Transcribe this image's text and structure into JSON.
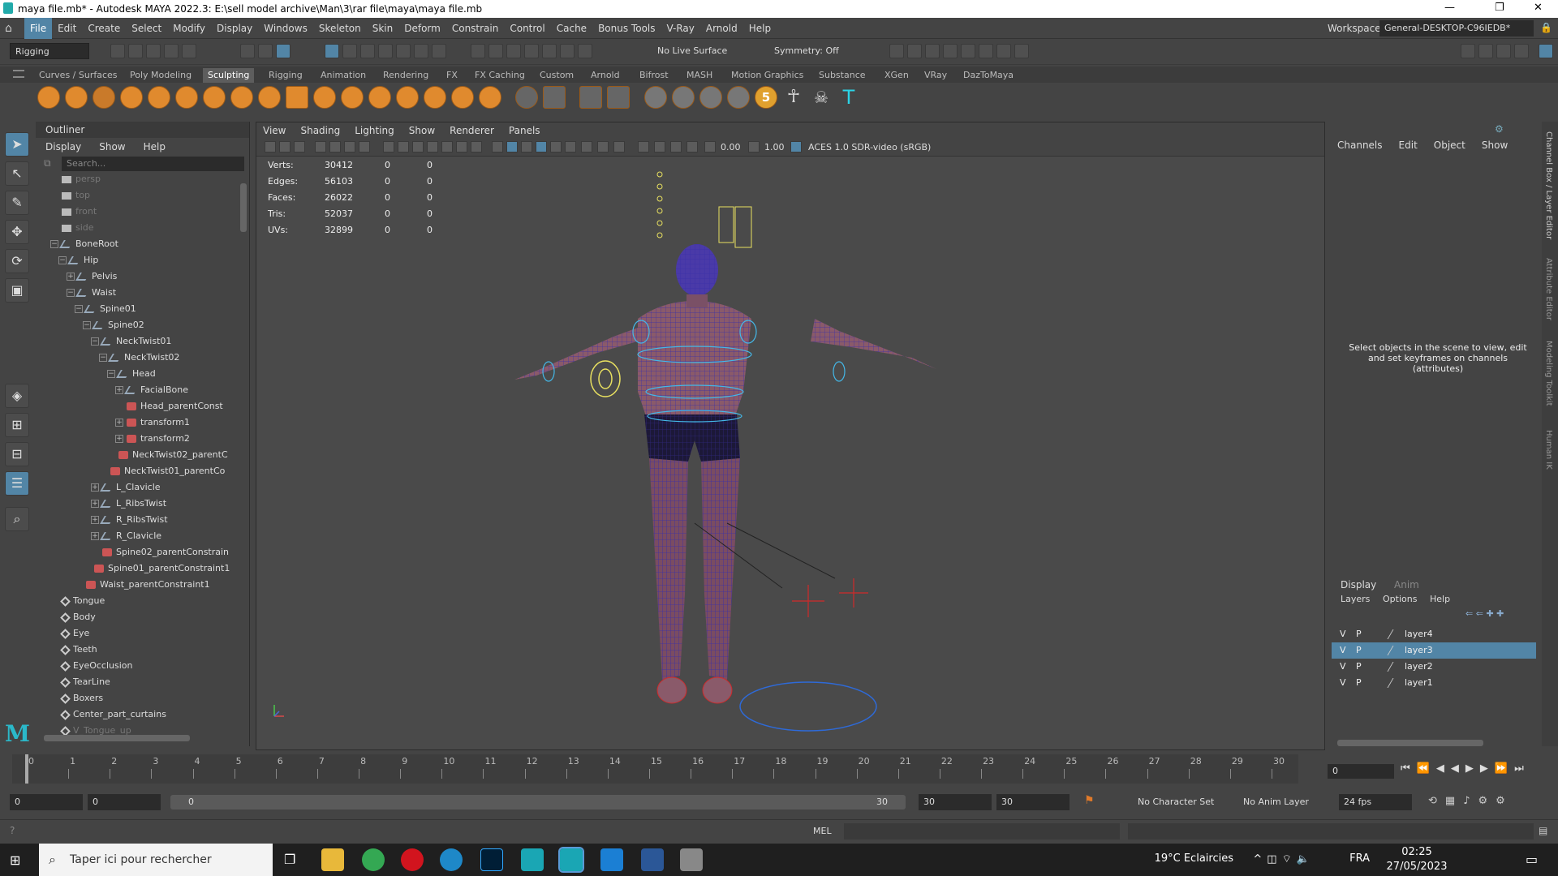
{
  "window": {
    "title": "maya file.mb* - Autodesk MAYA 2022.3: E:\\sell model archive\\Man\\3\\rar file\\maya\\maya file.mb"
  },
  "menubar": {
    "items": [
      "File",
      "Edit",
      "Create",
      "Select",
      "Modify",
      "Display",
      "Windows",
      "Skeleton",
      "Skin",
      "Deform",
      "Constrain",
      "Control",
      "Cache",
      "Bonus Tools",
      "V-Ray",
      "Arnold",
      "Help"
    ],
    "workspace_label": "Workspace:",
    "workspace_value": "General-DESKTOP-C96IEDB*"
  },
  "statusline": {
    "menuset": "Rigging",
    "live_surface": "No Live Surface",
    "symmetry": "Symmetry: Off"
  },
  "shelf": {
    "tabs": [
      "Curves / Surfaces",
      "Poly Modeling",
      "Sculpting",
      "Rigging",
      "Animation",
      "Rendering",
      "FX",
      "FX Caching",
      "Custom",
      "Arnold",
      "Bifrost",
      "MASH",
      "Motion Graphics",
      "Substance",
      "XGen",
      "VRay",
      "DazToMaya"
    ],
    "active_tab": "Sculpting",
    "brush_count_label": "5"
  },
  "outliner": {
    "title": "Outliner",
    "menus": [
      "Display",
      "Show",
      "Help"
    ],
    "search_placeholder": "Search...",
    "items": [
      {
        "label": "persp",
        "depth": 0,
        "icon": "cam",
        "dim": true,
        "exp": ""
      },
      {
        "label": "top",
        "depth": 0,
        "icon": "cam",
        "dim": true,
        "exp": ""
      },
      {
        "label": "front",
        "depth": 0,
        "icon": "cam",
        "dim": true,
        "exp": ""
      },
      {
        "label": "side",
        "depth": 0,
        "icon": "cam",
        "dim": true,
        "exp": ""
      },
      {
        "label": "BoneRoot",
        "depth": 0,
        "icon": "joint",
        "dim": false,
        "exp": "−"
      },
      {
        "label": "Hip",
        "depth": 1,
        "icon": "joint",
        "dim": false,
        "exp": "−"
      },
      {
        "label": "Pelvis",
        "depth": 2,
        "icon": "joint",
        "dim": false,
        "exp": "+"
      },
      {
        "label": "Waist",
        "depth": 2,
        "icon": "joint",
        "dim": false,
        "exp": "−"
      },
      {
        "label": "Spine01",
        "depth": 3,
        "icon": "joint",
        "dim": false,
        "exp": "−"
      },
      {
        "label": "Spine02",
        "depth": 4,
        "icon": "joint",
        "dim": false,
        "exp": "−"
      },
      {
        "label": "NeckTwist01",
        "depth": 5,
        "icon": "joint",
        "dim": false,
        "exp": "−"
      },
      {
        "label": "NeckTwist02",
        "depth": 6,
        "icon": "joint",
        "dim": false,
        "exp": "−"
      },
      {
        "label": "Head",
        "depth": 7,
        "icon": "joint",
        "dim": false,
        "exp": "−"
      },
      {
        "label": "FacialBone",
        "depth": 8,
        "icon": "joint",
        "dim": false,
        "exp": "+"
      },
      {
        "label": "Head_parentConst",
        "depth": 8,
        "icon": "constraint",
        "dim": false,
        "exp": ""
      },
      {
        "label": "transform1",
        "depth": 8,
        "icon": "constraint",
        "dim": false,
        "exp": "+"
      },
      {
        "label": "transform2",
        "depth": 8,
        "icon": "constraint",
        "dim": false,
        "exp": "+"
      },
      {
        "label": "NeckTwist02_parentC",
        "depth": 7,
        "icon": "constraint",
        "dim": false,
        "exp": ""
      },
      {
        "label": "NeckTwist01_parentCo",
        "depth": 6,
        "icon": "constraint",
        "dim": false,
        "exp": ""
      },
      {
        "label": "L_Clavicle",
        "depth": 5,
        "icon": "joint",
        "dim": false,
        "exp": "+"
      },
      {
        "label": "L_RibsTwist",
        "depth": 5,
        "icon": "joint",
        "dim": false,
        "exp": "+"
      },
      {
        "label": "R_RibsTwist",
        "depth": 5,
        "icon": "joint",
        "dim": false,
        "exp": "+"
      },
      {
        "label": "R_Clavicle",
        "depth": 5,
        "icon": "joint",
        "dim": false,
        "exp": "+"
      },
      {
        "label": "Spine02_parentConstrain",
        "depth": 5,
        "icon": "constraint",
        "dim": false,
        "exp": ""
      },
      {
        "label": "Spine01_parentConstraint1",
        "depth": 4,
        "icon": "constraint",
        "dim": false,
        "exp": ""
      },
      {
        "label": "Waist_parentConstraint1",
        "depth": 3,
        "icon": "constraint",
        "dim": false,
        "exp": ""
      },
      {
        "label": "Tongue",
        "depth": 0,
        "icon": "mesh",
        "dim": false,
        "exp": ""
      },
      {
        "label": "Body",
        "depth": 0,
        "icon": "mesh",
        "dim": false,
        "exp": ""
      },
      {
        "label": "Eye",
        "depth": 0,
        "icon": "mesh",
        "dim": false,
        "exp": ""
      },
      {
        "label": "Teeth",
        "depth": 0,
        "icon": "mesh",
        "dim": false,
        "exp": ""
      },
      {
        "label": "EyeOcclusion",
        "depth": 0,
        "icon": "mesh",
        "dim": false,
        "exp": ""
      },
      {
        "label": "TearLine",
        "depth": 0,
        "icon": "mesh",
        "dim": false,
        "exp": ""
      },
      {
        "label": "Boxers",
        "depth": 0,
        "icon": "mesh",
        "dim": false,
        "exp": ""
      },
      {
        "label": "Center_part_curtains",
        "depth": 0,
        "icon": "mesh",
        "dim": false,
        "exp": ""
      },
      {
        "label": "V_Tongue_up",
        "depth": 0,
        "icon": "mesh",
        "dim": true,
        "exp": ""
      }
    ]
  },
  "viewport": {
    "menus": [
      "View",
      "Shading",
      "Lighting",
      "Show",
      "Renderer",
      "Panels"
    ],
    "exposure": "0.00",
    "gamma": "1.00",
    "color_space": "ACES 1.0 SDR-video (sRGB)",
    "hud": [
      {
        "label": "Verts:",
        "v1": "30412",
        "v2": "0",
        "v3": "0"
      },
      {
        "label": "Edges:",
        "v1": "56103",
        "v2": "0",
        "v3": "0"
      },
      {
        "label": "Faces:",
        "v1": "26022",
        "v2": "0",
        "v3": "0"
      },
      {
        "label": "Tris:",
        "v1": "52037",
        "v2": "0",
        "v3": "0"
      },
      {
        "label": "UVs:",
        "v1": "32899",
        "v2": "0",
        "v3": "0"
      }
    ]
  },
  "channelbox": {
    "menus": [
      "Channels",
      "Edit",
      "Object",
      "Show"
    ],
    "message": "Select objects in the scene to view, edit and set keyframes on channels (attributes)",
    "layer_tabs": [
      "Display",
      "Anim"
    ],
    "layer_menus": [
      "Layers",
      "Options",
      "Help"
    ],
    "layers": [
      {
        "v": "V",
        "p": "P",
        "name": "layer4",
        "selected": false
      },
      {
        "v": "V",
        "p": "P",
        "name": "layer3",
        "selected": true
      },
      {
        "v": "V",
        "p": "P",
        "name": "layer2",
        "selected": false
      },
      {
        "v": "V",
        "p": "P",
        "name": "layer1",
        "selected": false
      }
    ],
    "side_tabs": [
      "Channel Box / Layer Editor",
      "Attribute Editor",
      "Modeling Toolkit",
      "Human IK"
    ]
  },
  "timeline": {
    "frames": [
      "0",
      "1",
      "2",
      "3",
      "4",
      "5",
      "6",
      "7",
      "8",
      "9",
      "10",
      "11",
      "12",
      "13",
      "14",
      "15",
      "16",
      "17",
      "18",
      "19",
      "20",
      "21",
      "22",
      "23",
      "24",
      "25",
      "26",
      "27",
      "28",
      "29",
      "30"
    ],
    "current_frame": "0"
  },
  "range": {
    "start": "0",
    "inner_start": "0",
    "slider_start": "0",
    "slider_end": "30",
    "inner_end": "30",
    "end": "30",
    "character_set": "No Character Set",
    "anim_layer": "No Anim Layer",
    "fps": "24 fps"
  },
  "cmdline": {
    "language": "MEL"
  },
  "taskbar": {
    "search_placeholder": "Taper ici pour rechercher",
    "weather": "19°C  Eclaircies",
    "lang": "FRA",
    "time": "02:25",
    "date": "27/05/2023"
  },
  "colors": {
    "accent": "#5285a6",
    "panel": "#444444",
    "shelf_icon": "#e08a2e"
  }
}
